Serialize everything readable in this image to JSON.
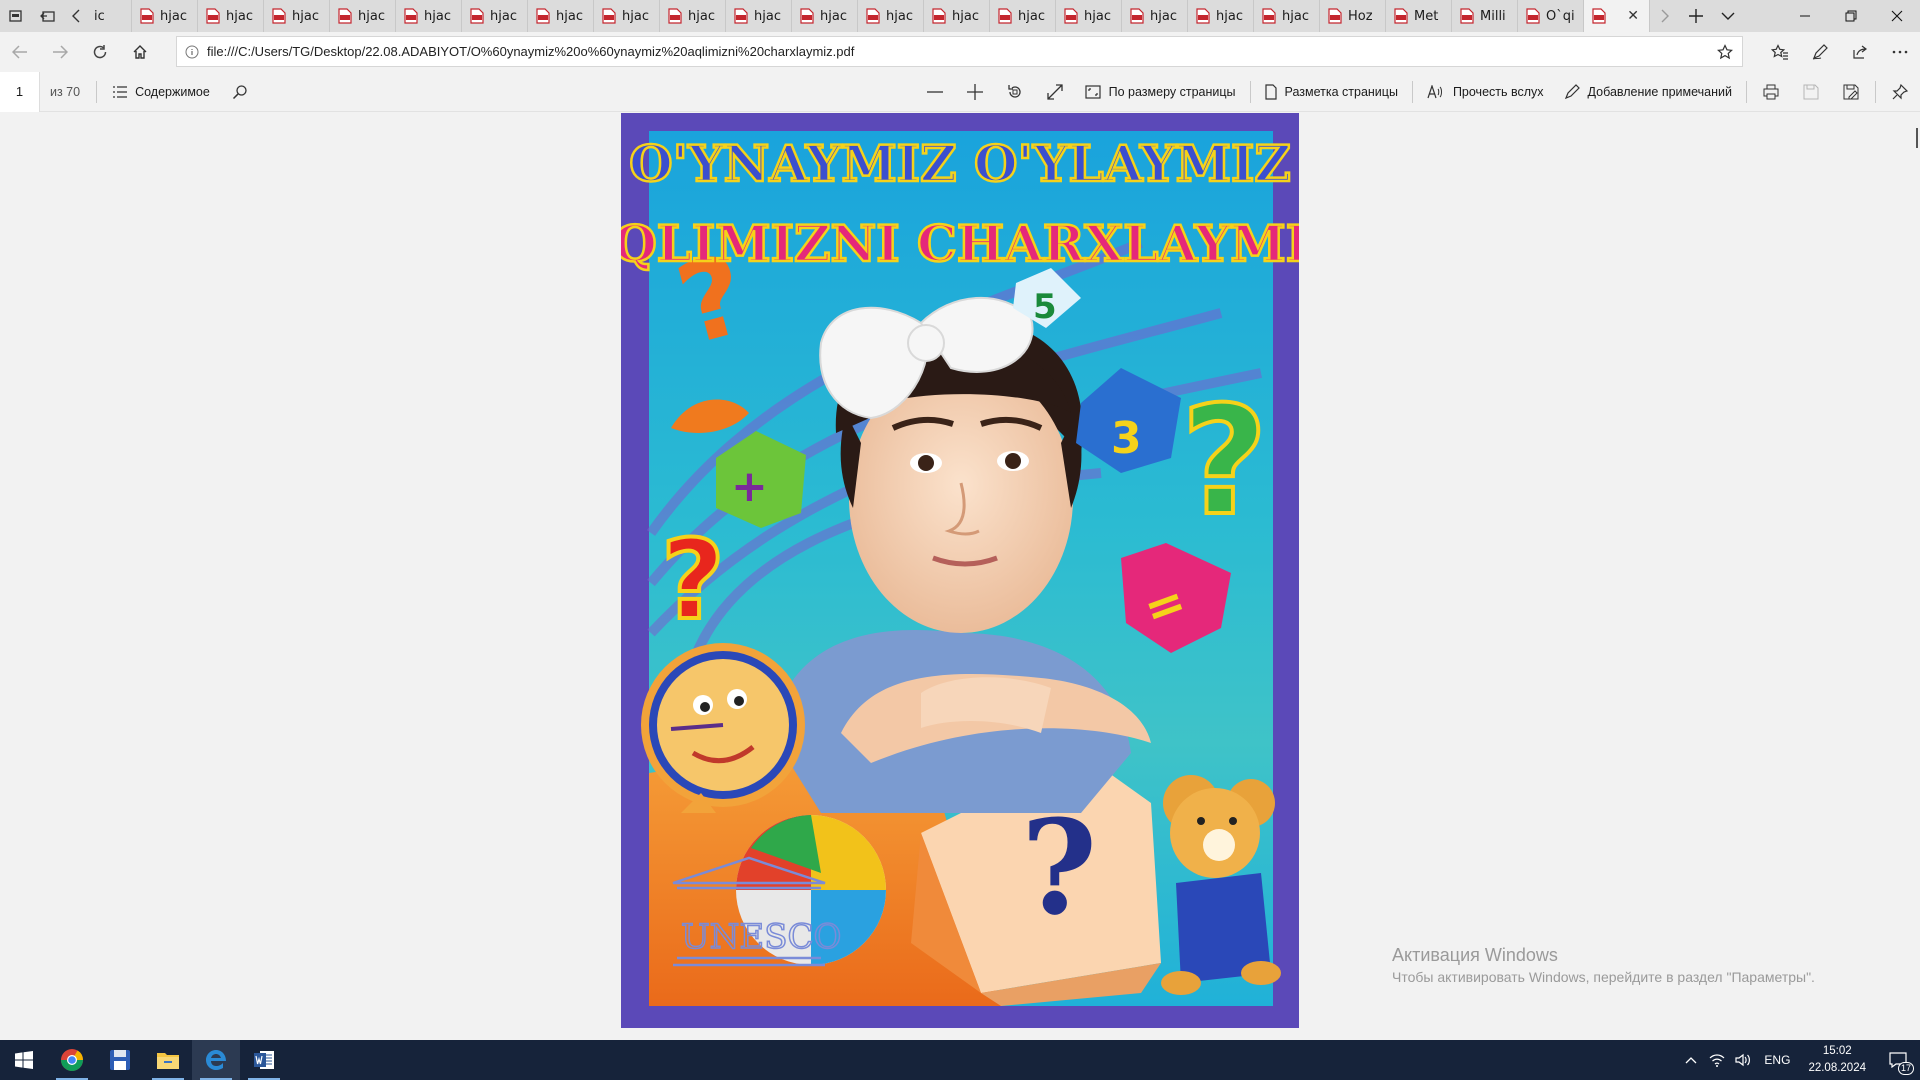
{
  "tabbar": {
    "first_tab_label": "ic",
    "tabs": [
      {
        "label": "hjac"
      },
      {
        "label": "hjac"
      },
      {
        "label": "hjac"
      },
      {
        "label": "hjac"
      },
      {
        "label": "hjac"
      },
      {
        "label": "hjac"
      },
      {
        "label": "hjac"
      },
      {
        "label": "hjac"
      },
      {
        "label": "hjac"
      },
      {
        "label": "hjac"
      },
      {
        "label": "hjac"
      },
      {
        "label": "hjac"
      },
      {
        "label": "hjac"
      },
      {
        "label": "hjac"
      },
      {
        "label": "hjac"
      },
      {
        "label": "hjac"
      },
      {
        "label": "hjac"
      },
      {
        "label": "hjac"
      },
      {
        "label": "Hoz"
      },
      {
        "label": "Met"
      },
      {
        "label": "Milli"
      },
      {
        "label": "O`qi"
      }
    ],
    "active_tab_label": ""
  },
  "address": {
    "url": "file:///C:/Users/TG/Desktop/22.08.ADABIYOT/O%60ynaymiz%20o%60ynaymiz%20aqlimizni%20charxlaymiz.pdf"
  },
  "pdf_toolbar": {
    "page_number": "1",
    "page_count": "из 70",
    "contents_label": "Содержимое",
    "fit_page_label": "По размеру страницы",
    "page_layout_label": "Разметка страницы",
    "read_aloud_label": "Прочесть вслух",
    "add_notes_label": "Добавление примечаний"
  },
  "cover": {
    "title_line1": "O'YNAYMIZ O'YLAYMIZ",
    "title_line2": "AQLIMIZNI CHARXLAYMIZ",
    "logo_text": "UNESCO",
    "cube_labels": [
      "5",
      "3",
      "+",
      "="
    ],
    "colors": {
      "border": "#5b49b8",
      "background_top": "#1fa0d8",
      "background_bottom": "#f07a1e"
    }
  },
  "watermark": {
    "line1": "Активация Windows",
    "line2": "Чтобы активировать Windows, перейдите в раздел \"Параметры\"."
  },
  "taskbar": {
    "apps": [
      "start-icon",
      "chrome-icon",
      "save-app-icon",
      "file-explorer-icon",
      "edge-icon",
      "word-icon"
    ],
    "language": "ENG",
    "time": "15:02",
    "date": "22.08.2024",
    "notification_count": "17"
  }
}
